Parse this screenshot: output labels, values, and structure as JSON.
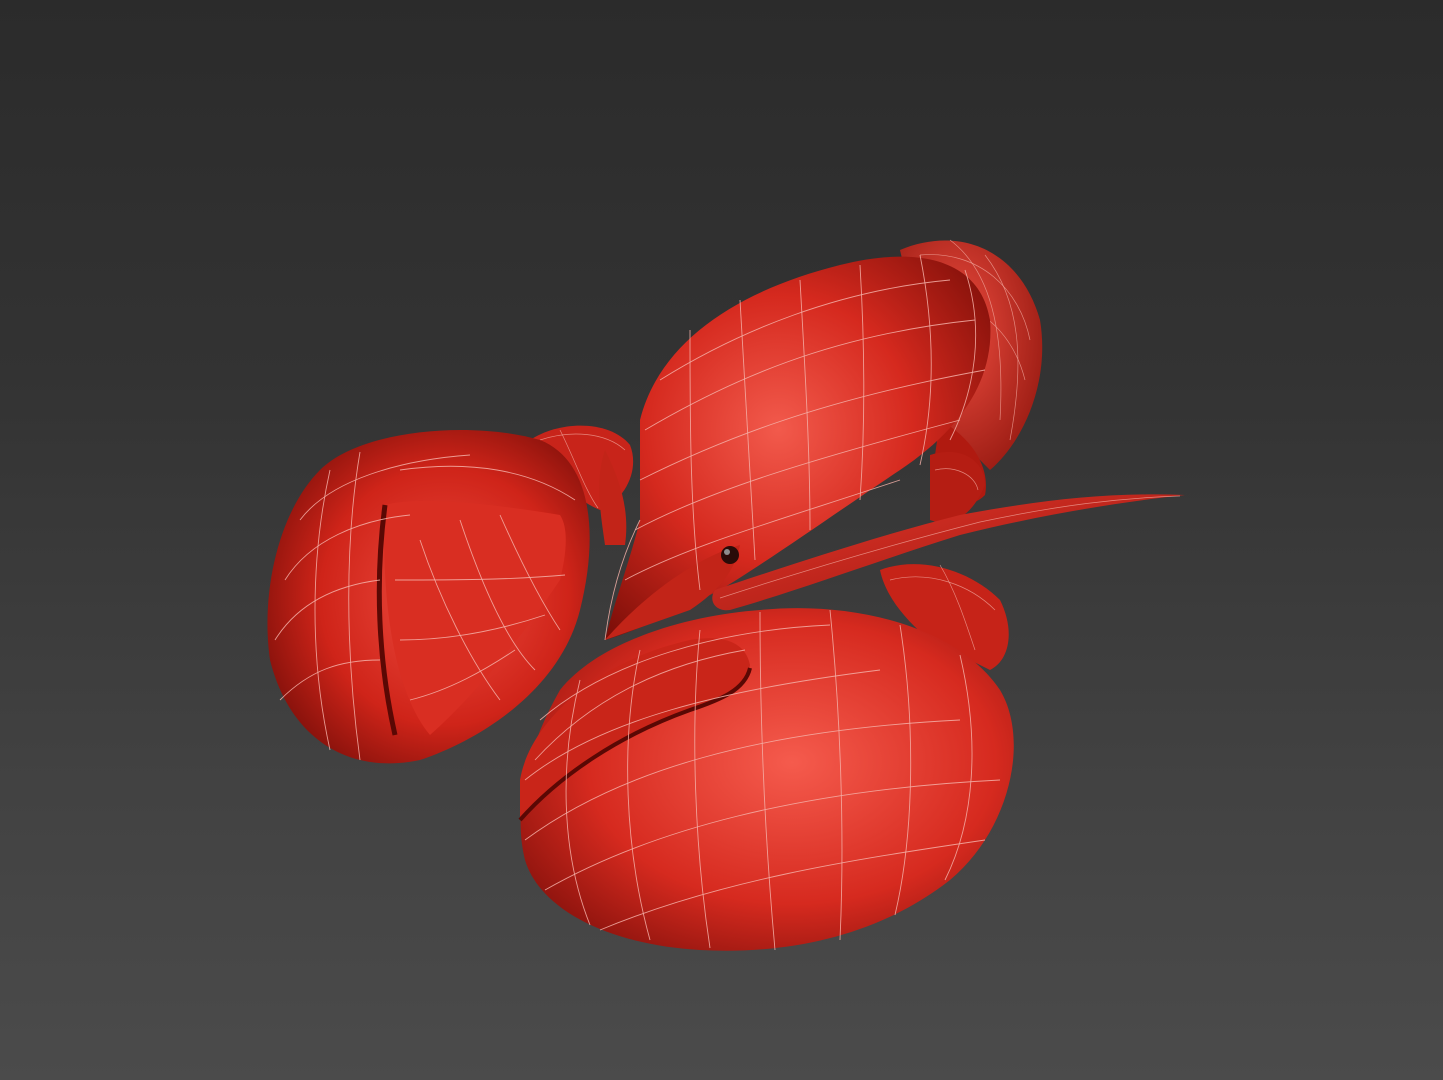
{
  "viewport": {
    "background_top": "#2b2b2b",
    "background_bottom": "#4b4b4b",
    "shading_mode": "wireframe-over-shaded"
  },
  "model": {
    "subject": "lobster",
    "base_color": "#d42a20",
    "highlight_color": "#f0564a",
    "shadow_color": "#6e0c08",
    "wireframe_color": "#f4b0a8"
  }
}
